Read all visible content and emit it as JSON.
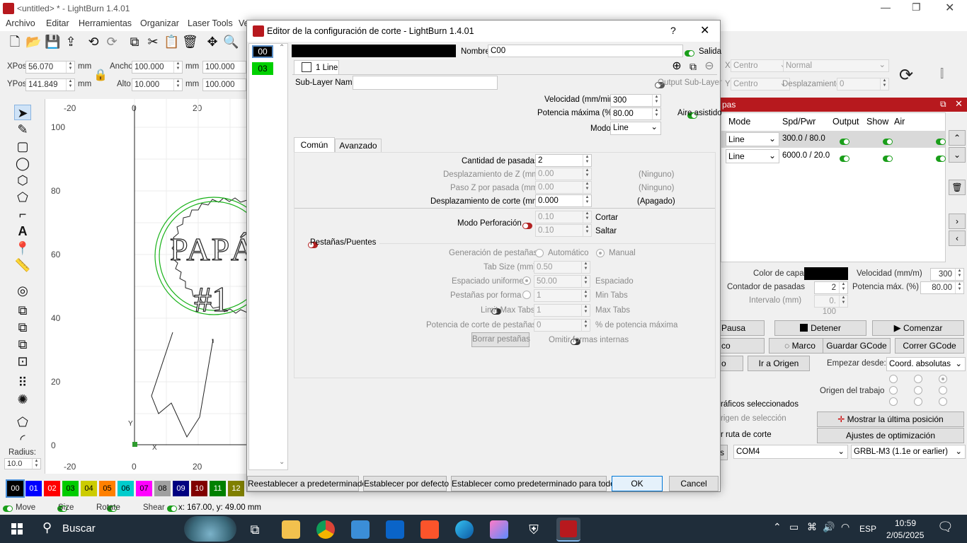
{
  "app": {
    "title": "<untitled> * - LightBurn 1.4.01",
    "menu": [
      "Archivo",
      "Editar",
      "Herramientas",
      "Organizar",
      "Laser Tools",
      "Ve"
    ]
  },
  "coords": {
    "xpos_label": "XPos",
    "xpos_value": "56.070",
    "ypos_label": "YPos",
    "ypos_value": "141.849",
    "unit": "mm",
    "ancho_label": "Ancho",
    "ancho_value": "100.000",
    "alto_label": "Alto",
    "alto_value": "10.000",
    "pct1": "100.000",
    "pct2": "100.000"
  },
  "ruler": {
    "x": [
      "-20",
      "0",
      "20"
    ],
    "y": [
      "100",
      "80",
      "60",
      "40",
      "20",
      "0"
    ],
    "bottom_x": [
      "-20",
      "0",
      "20"
    ],
    "axis_y": "Y",
    "axis_x": "X"
  },
  "radius": {
    "label": "Radius:",
    "value": "10.0"
  },
  "palette": [
    "00",
    "01",
    "02",
    "03",
    "04",
    "05",
    "06",
    "07",
    "08",
    "09",
    "10",
    "11",
    "12"
  ],
  "palette_colors": [
    "#000000",
    "#0000ff",
    "#ff0000",
    "#00cc00",
    "#cccc00",
    "#ff8000",
    "#00cccc",
    "#ff00ff",
    "#a0a0a0",
    "#000080",
    "#800000",
    "#008000",
    "#808000"
  ],
  "status": {
    "move": "Move",
    "size": "Size",
    "rotate": "Rotate",
    "shear": "Shear",
    "coords": "x: 167.00, y: 49.00 mm"
  },
  "right": {
    "x_label": "X",
    "x_select": "Centro",
    "y_label": "Y",
    "y_select": "Centro",
    "normal": "Normal",
    "desplazamiento_label": "Desplazamiento",
    "desplazamiento_value": "0",
    "panel_title": "pas",
    "headers": [
      "Mode",
      "Spd/Pwr",
      "Output",
      "Show",
      "Air"
    ],
    "rows": [
      {
        "mode": "Line",
        "spdpwr": "300.0 / 80.0"
      },
      {
        "mode": "Line",
        "spdpwr": "6000.0 / 20.0"
      }
    ],
    "color_capa": "Color de capa",
    "velocidad_label": "Velocidad (mm/m)",
    "velocidad_value": "300",
    "contador_label": "Contador de pasadas",
    "contador_value": "2",
    "potencia_label": "Potencia máx. (%)",
    "potencia_value": "80.00",
    "intervalo_label": "Intervalo (mm)",
    "intervalo_value": "0. 100",
    "pausa": "Pausa",
    "detener": "Detener",
    "comenzar": "Comenzar",
    "co": "co",
    "marco": "Marco",
    "guardar": "Guardar GCode",
    "correr": "Correr GCode",
    "o": "o",
    "ir_origen": "Ir a Origen",
    "empezar_label": "Empezar desde:",
    "empezar_value": "Coord. absolutas",
    "origen_trabajo": "Origen del trabajo",
    "graficos": "ráficos seleccionados",
    "origen_sel": "rigen de selección",
    "mostrar": "Mostrar la última posición",
    "ruta": "r ruta de corte",
    "ajustes": "Ajustes de optimización",
    "s": "s",
    "com": "COM4",
    "grbl": "GRBL-M3 (1.1e or earlier)"
  },
  "dialog": {
    "title": "Editor de la configuración de corte - LightBurn 1.4.01",
    "help": "?",
    "close": "✕",
    "layers": [
      "00",
      "03"
    ],
    "nombre_label": "Nombre",
    "nombre_value": "C00",
    "salida": "Salida",
    "sublayer_tab": "1 Line",
    "sublayer_name_label": "Sub-Layer Name",
    "output_sublayer": "Output Sub-Layer",
    "velocidad_label": "Velocidad (mm/min)",
    "velocidad_value": "300",
    "potencia_label": "Potencia máxima (%)",
    "potencia_value": "80.00",
    "aire": "Aire asistido",
    "modo_label": "Modo",
    "modo_value": "Line",
    "tabs": [
      "Común",
      "Avanzado"
    ],
    "pasadas_label": "Cantidad de pasadas",
    "pasadas_value": "2",
    "desz_label": "Desplazamiento de Z (mm)",
    "desz_value": "0.00",
    "desz_note": "(Ninguno)",
    "pasoz_label": "Paso Z por pasada (mm)",
    "pasoz_value": "0.00",
    "pasoz_note": "(Ninguno)",
    "descorte_label": "Desplazamiento de corte (mm)",
    "descorte_value": "0.000",
    "descorte_note": "(Apagado)",
    "perf_label": "Modo Perforación",
    "perf_cortar_value": "0.10",
    "perf_cortar": "Cortar",
    "perf_saltar_value": "0.10",
    "perf_saltar": "Saltar",
    "pestanas": "Pestañas/Puentes",
    "gen_label": "Generación de pestañas",
    "gen_auto": "Automático",
    "gen_manual": "Manual",
    "tabsize_label": "Tab Size (mm)",
    "tabsize_value": "0.50",
    "espuni_label": "Espaciado uniforme",
    "espuni_value": "50.00",
    "espuni_unit": "Espaciado",
    "porforma_label": "Pestañas por forma",
    "porforma_value": "1",
    "porforma_unit": "Min Tabs",
    "limit_label": "Limit Max Tabs",
    "limit_value": "1",
    "limit_unit": "Max Tabs",
    "potpest_label": "Potencia de corte de pestañas",
    "potpest_value": "0",
    "potpest_unit": "% de potencia máxima",
    "borrar": "Borrar pestañas",
    "omitir": "Omitir formas internas",
    "btn_reset": "Reestablecer a predeterminado",
    "btn_def": "Establecer por defecto",
    "btn_all": "Establecer como predeterminado para todos",
    "ok": "OK",
    "cancel": "Cancel"
  },
  "design": {
    "text1": "PAPÁ",
    "text2": "#1"
  },
  "taskbar": {
    "search": "Buscar",
    "time": "10:59",
    "date": "2/05/2025",
    "lang": "ESP"
  }
}
